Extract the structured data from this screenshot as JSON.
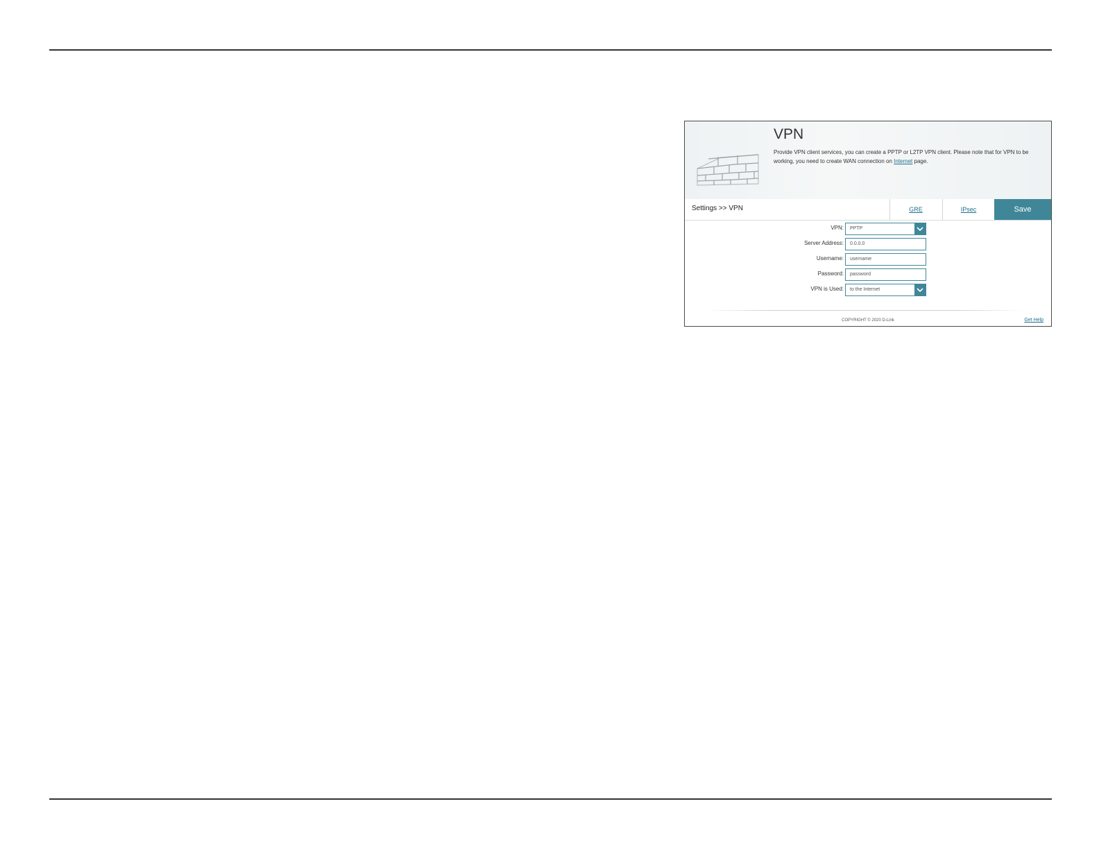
{
  "header": {
    "title": "VPN",
    "description_part1": "Provide VPN client services, you can create a PPTP or L2TP VPN client. Please note that for VPN to be working, you need to create WAN connection on ",
    "description_link": "Internet",
    "description_part2": " page."
  },
  "toolbar": {
    "breadcrumb": "Settings >> VPN",
    "tab_gre": "GRE",
    "tab_ipsec": "IPsec",
    "save_label": "Save"
  },
  "form": {
    "vpn_label": "VPN:",
    "vpn_value": "PPTP",
    "server_label": "Server Address:",
    "server_placeholder": "0.0.0.0",
    "username_label": "Username:",
    "username_placeholder": "username",
    "password_label": "Password:",
    "password_placeholder": "password",
    "used_label": "VPN is Used:",
    "used_value": "to the Internet"
  },
  "footer": {
    "copyright": "COPYRIGHT © 2020 D-Link",
    "help": "Get Help"
  },
  "colors": {
    "accent": "#3f8798",
    "link": "#1e6e8a"
  },
  "icons": {
    "hero": "brick-wall-icon",
    "dropdown": "chevron-down-icon"
  }
}
